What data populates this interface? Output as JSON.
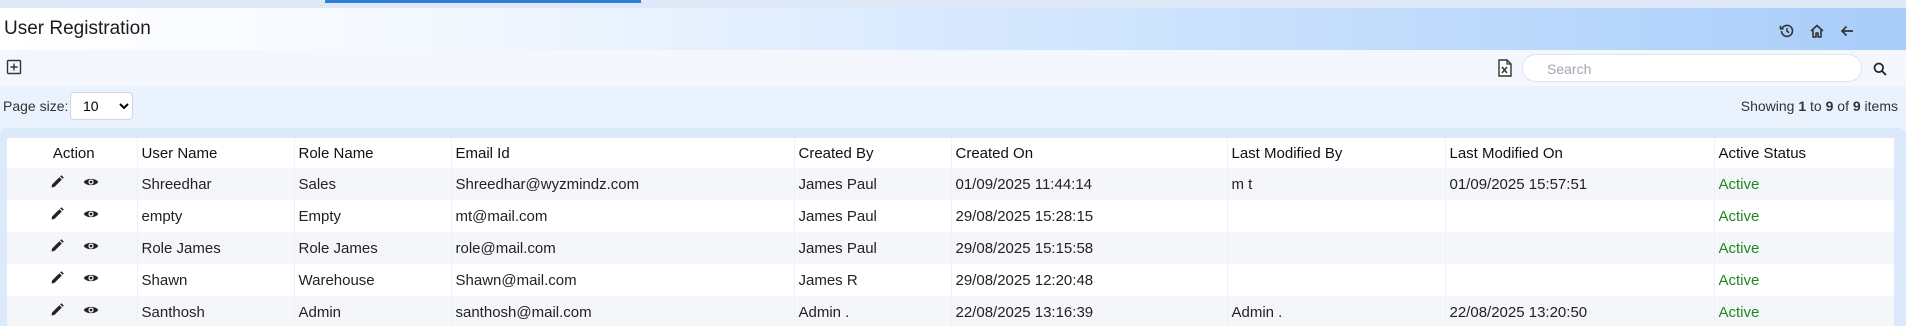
{
  "header": {
    "title": "User Registration",
    "icons": [
      "history-icon",
      "home-icon",
      "back-arrow-icon"
    ]
  },
  "toolbar": {
    "search_placeholder": "Search"
  },
  "pagination": {
    "page_size_label": "Page size:",
    "page_size_value": "10",
    "page_size_options": [
      "10"
    ],
    "showing_prefix": "Showing",
    "showing_from": "1",
    "showing_to_word": "to",
    "showing_to": "9",
    "showing_of_word": "of",
    "showing_total": "9",
    "showing_suffix": "items"
  },
  "table": {
    "columns": [
      "Action",
      "User Name",
      "Role Name",
      "Email Id",
      "Created By",
      "Created On",
      "Last Modified By",
      "Last Modified On",
      "Active Status"
    ],
    "rows": [
      {
        "user_name": "Shreedhar",
        "role_name": "Sales",
        "email": "Shreedhar@wyzmindz.com",
        "created_by": "James Paul",
        "created_on": "01/09/2025 11:44:14",
        "last_modified_by": "m t",
        "last_modified_on": "01/09/2025 15:57:51",
        "status": "Active"
      },
      {
        "user_name": "empty",
        "role_name": "Empty",
        "email": "mt@mail.com",
        "created_by": "James Paul",
        "created_on": "29/08/2025 15:28:15",
        "last_modified_by": "",
        "last_modified_on": "",
        "status": "Active"
      },
      {
        "user_name": "Role James",
        "role_name": "Role James",
        "email": "role@mail.com",
        "created_by": "James Paul",
        "created_on": "29/08/2025 15:15:58",
        "last_modified_by": "",
        "last_modified_on": "",
        "status": "Active"
      },
      {
        "user_name": "Shawn",
        "role_name": "Warehouse",
        "email": "Shawn@mail.com",
        "created_by": "James R",
        "created_on": "29/08/2025 12:20:48",
        "last_modified_by": "",
        "last_modified_on": "",
        "status": "Active"
      },
      {
        "user_name": "Santhosh",
        "role_name": "Admin",
        "email": "santhosh@mail.com",
        "created_by": "Admin .",
        "created_on": "22/08/2025 13:16:39",
        "last_modified_by": "Admin .",
        "last_modified_on": "22/08/2025 13:20:50",
        "status": "Active"
      }
    ]
  },
  "colors": {
    "accent": "#2f7fd8",
    "status_active": "#1e8a1e"
  }
}
